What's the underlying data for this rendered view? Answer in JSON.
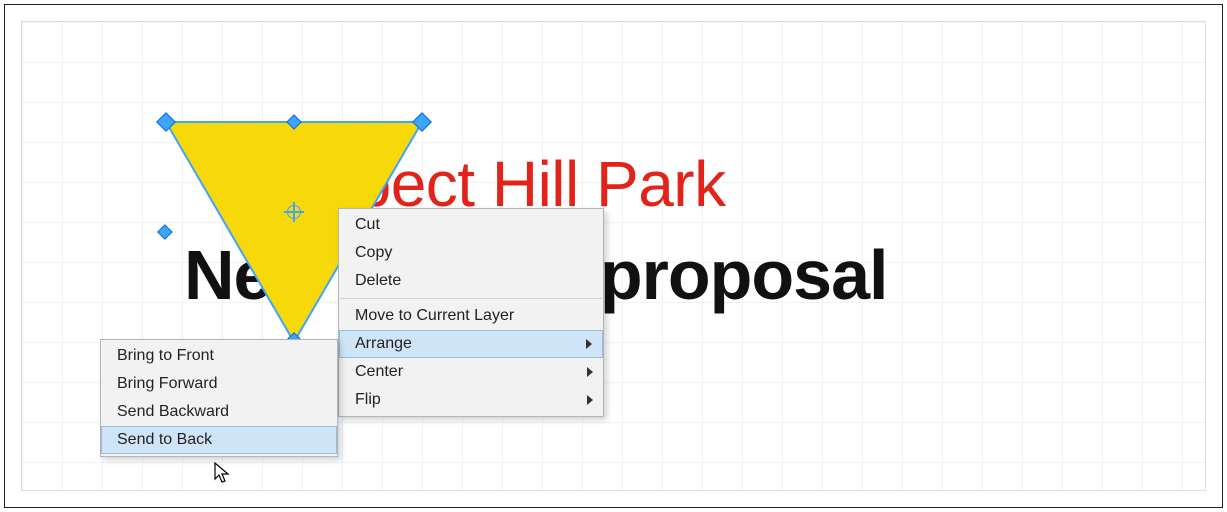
{
  "canvas": {
    "title_red": "Prospect Hill Park",
    "title_black": "New seating proposal"
  },
  "shape": {
    "kind": "triangle",
    "fill": "#f7d909",
    "stroke": "#3ea5ff",
    "selected": true
  },
  "context_menu": {
    "items": [
      {
        "label": "Cut"
      },
      {
        "label": "Copy"
      },
      {
        "label": "Delete"
      },
      {
        "sep": true
      },
      {
        "label": "Move to Current Layer"
      },
      {
        "label": "Arrange",
        "submenu": true,
        "highlight": true
      },
      {
        "label": "Center",
        "submenu": true
      },
      {
        "label": "Flip",
        "submenu": true
      }
    ],
    "arrange_submenu": [
      {
        "label": "Bring to Front"
      },
      {
        "label": "Bring Forward"
      },
      {
        "label": "Send Backward"
      },
      {
        "label": "Send to Back",
        "highlight": true
      }
    ]
  }
}
